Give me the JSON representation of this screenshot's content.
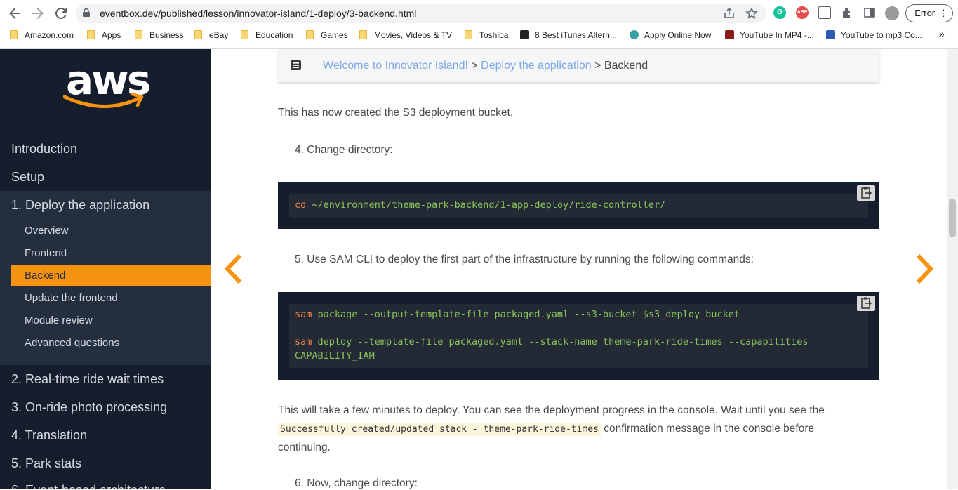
{
  "browser": {
    "url": "eventbox.dev/published/lesson/innovator-island/1-deploy/3-backend.html",
    "error_label": "Error",
    "bookmarks": [
      {
        "label": "Amazon.com"
      },
      {
        "label": "Apps"
      },
      {
        "label": "Business"
      },
      {
        "label": "eBay"
      },
      {
        "label": "Education"
      },
      {
        "label": "Games"
      },
      {
        "label": "Movies, Videos & TV"
      },
      {
        "label": "Toshiba"
      },
      {
        "label": "8 Best iTunes Altern..."
      },
      {
        "label": "Apply Online Now"
      },
      {
        "label": "YouTube In MP4 -..."
      },
      {
        "label": "YouTube to mp3 Co..."
      }
    ],
    "more_bookmarks": "»"
  },
  "sidebar": {
    "logo_text": "aws",
    "top_items": [
      {
        "label": "Introduction"
      },
      {
        "label": "Setup"
      }
    ],
    "active_section": {
      "number": "1.",
      "label": "Deploy the application"
    },
    "sub_items": [
      {
        "label": "Overview"
      },
      {
        "label": "Frontend"
      },
      {
        "label": "Backend"
      },
      {
        "label": "Update the frontend"
      },
      {
        "label": "Module review"
      },
      {
        "label": "Advanced questions"
      }
    ],
    "sections": [
      {
        "number": "2.",
        "label": "Real-time ride wait times"
      },
      {
        "number": "3.",
        "label": "On-ride photo processing"
      },
      {
        "number": "4.",
        "label": "Translation"
      },
      {
        "number": "5.",
        "label": "Park stats"
      },
      {
        "number": "6.",
        "label": "Event-based architecture"
      }
    ]
  },
  "breadcrumb": {
    "item1": "Welcome to Innovator Island!",
    "sep": ">",
    "item2": "Deploy the application",
    "current": "Backend"
  },
  "content": {
    "intro": "This has now created the S3 deployment bucket.",
    "step4": "4. Change directory:",
    "code1": {
      "cmd": "cd",
      "args": " ~/environment/theme-park-backend/1-app-deploy/ride-controller/"
    },
    "step5": "5. Use SAM CLI to deploy the first part of the infrastructure by running the following commands:",
    "code2": {
      "line1_cmd": "sam",
      "line1_args": " package --output-template-file packaged.yaml --s3-bucket $s3_deploy_bucket",
      "line2_cmd": "sam",
      "line2_args": " deploy --template-file packaged.yaml --stack-name theme-park-ride-times --capabilities",
      "line3": "CAPABILITY_IAM"
    },
    "deploy_text_1": "This will take a few minutes to deploy. You can see the deployment progress in the console. Wait until you see the",
    "deploy_inline_code": "Successfully created/updated stack - theme-park-ride-times",
    "deploy_text_2": " confirmation message in the console before",
    "deploy_text_3": "continuing.",
    "step6": "6. Now, change directory:"
  },
  "colors": {
    "sidebar_bg": "#161e2d",
    "accent_orange": "#f7930f",
    "link_blue": "#7ea9e8",
    "code_green": "#8bc35a",
    "code_keyword": "#f0844a"
  }
}
